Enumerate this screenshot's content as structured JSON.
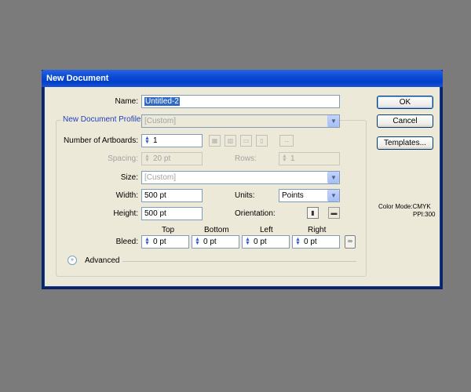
{
  "window": {
    "title": "New Document"
  },
  "form": {
    "name_label": "Name:",
    "name_value": "Untitled-2",
    "profile_label": "New Document Profile:",
    "profile_value": "[Custom]",
    "artboards_label": "Number of Artboards:",
    "artboards_value": "1",
    "spacing_label": "Spacing:",
    "spacing_value": "20 pt",
    "rows_label": "Rows:",
    "rows_value": "1",
    "size_label": "Size:",
    "size_value": "[Custom]",
    "width_label": "Width:",
    "width_value": "500 pt",
    "units_label": "Units:",
    "units_value": "Points",
    "height_label": "Height:",
    "height_value": "500 pt",
    "orientation_label": "Orientation:",
    "bleed_label": "Bleed:",
    "bleed_top_label": "Top",
    "bleed_bottom_label": "Bottom",
    "bleed_left_label": "Left",
    "bleed_right_label": "Right",
    "bleed_top": "0 pt",
    "bleed_bottom": "0 pt",
    "bleed_left": "0 pt",
    "bleed_right": "0 pt",
    "advanced_label": "Advanced"
  },
  "buttons": {
    "ok": "OK",
    "cancel": "Cancel",
    "templates": "Templates..."
  },
  "info": {
    "color_mode": "Color Mode:CMYK",
    "ppi": "PPI:300"
  },
  "icons": {
    "spinner": "spinner-arrows-icon",
    "dropdown": "chevron-down-icon",
    "grid_by_row": "grid-by-row-icon",
    "grid_by_column": "grid-by-column-icon",
    "arrange_by_row": "arrange-by-row-icon",
    "arrange_by_column": "arrange-by-column-icon",
    "layout_direction": "right-to-left-layout-icon",
    "portrait": "portrait-orientation-icon",
    "landscape": "landscape-orientation-icon",
    "link": "link-bleed-icon",
    "expand": "expand-chevron-icon"
  },
  "colors": {
    "titlebar": "#0b4ad6",
    "dialog_bg": "#ece9d8",
    "desktop_bg": "#7b7b7b",
    "accent_text": "#1f3fbf"
  }
}
